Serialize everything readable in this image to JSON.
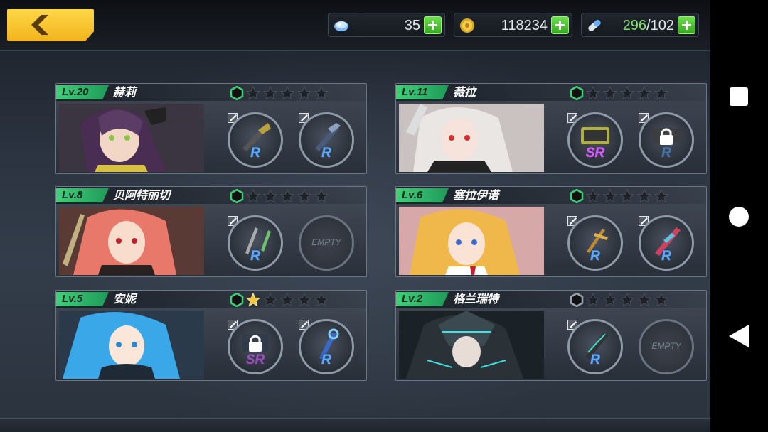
{
  "resources": {
    "gems": "35",
    "gold": "118234",
    "stamina_current": "296",
    "stamina_max": "/102"
  },
  "characters": [
    {
      "level": "Lv.20",
      "name": "赫莉",
      "stars": 0,
      "weapons": [
        {
          "rank": "R"
        },
        {
          "rank": "R"
        }
      ]
    },
    {
      "level": "Lv.11",
      "name": "薇拉",
      "stars": 0,
      "weapons": [
        {
          "rank": "SR"
        },
        {
          "rank": "R",
          "locked": true
        }
      ]
    },
    {
      "level": "Lv.8",
      "name": "贝阿特丽切",
      "stars": 0,
      "weapons": [
        {
          "rank": "R"
        },
        {
          "empty": "EMPTY"
        }
      ]
    },
    {
      "level": "Lv.6",
      "name": "塞拉伊诺",
      "stars": 0,
      "weapons": [
        {
          "rank": "R"
        },
        {
          "rank": "R"
        }
      ]
    },
    {
      "level": "Lv.5",
      "name": "安妮",
      "stars": 1,
      "weapons": [
        {
          "rank": "SR",
          "locked": true
        },
        {
          "rank": "R"
        }
      ]
    },
    {
      "level": "Lv.2",
      "name": "格兰瑞特",
      "stars": 0,
      "weapons": [
        {
          "rank": "R"
        },
        {
          "empty": "EMPTY"
        }
      ]
    }
  ],
  "colors": {
    "level_badge": "#3fd07a",
    "rank_r": "#5aa8ff",
    "rank_sr": "#d35cff",
    "plus_button": "#4cc832",
    "back_button": "#f2b41a"
  },
  "icons": {
    "gem": "gem-icon",
    "gold": "gold-coin-icon",
    "stamina": "stamina-capsule-icon"
  }
}
